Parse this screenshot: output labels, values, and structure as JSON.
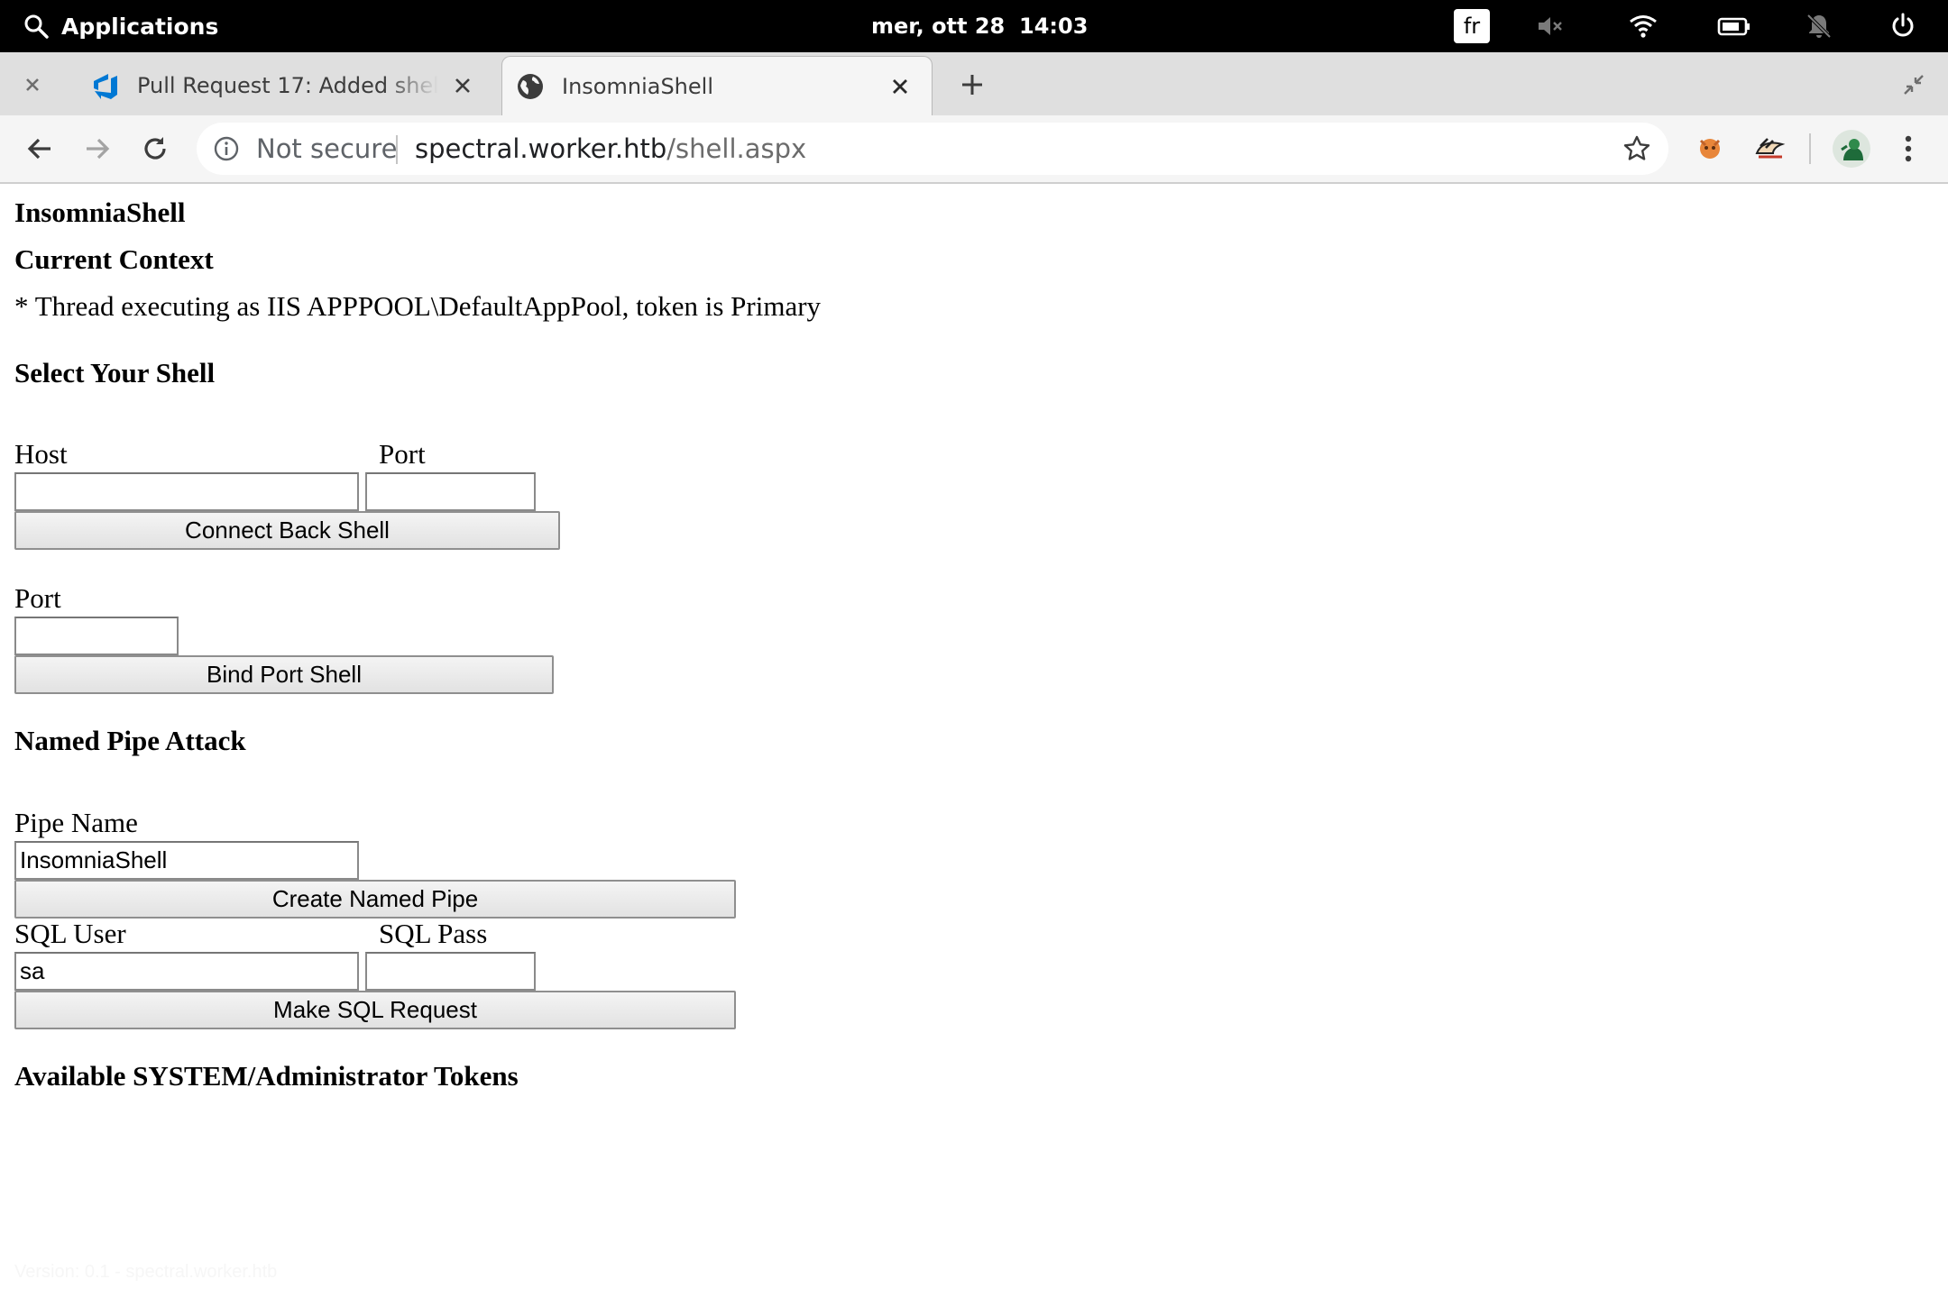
{
  "system_bar": {
    "applications_label": "Applications",
    "date": "mer, ott 28",
    "time": "14:03",
    "keyboard_layout": "fr"
  },
  "browser": {
    "tabs": [
      {
        "title": "Pull Request 17: Added shell.aspx",
        "icon": "azure-devops-icon",
        "active": false
      },
      {
        "title": "InsomniaShell",
        "icon": "globe-icon",
        "active": true
      }
    ],
    "omnibox": {
      "security_label": "Not secure",
      "url_host": "spectral.worker.htb",
      "url_path": "/shell.aspx"
    }
  },
  "page": {
    "title": "InsomniaShell",
    "current_context_heading": "Current Context",
    "context_line": "* Thread executing as IIS APPPOOL\\DefaultAppPool, token is Primary",
    "select_shell_heading": "Select Your Shell",
    "connect_back": {
      "host_label": "Host",
      "port_label": "Port",
      "host_value": "",
      "port_value": "",
      "button": "Connect Back Shell"
    },
    "bind_port": {
      "port_label": "Port",
      "port_value": "",
      "button": "Bind Port Shell"
    },
    "named_pipe_heading": "Named Pipe Attack",
    "named_pipe": {
      "pipe_name_label": "Pipe Name",
      "pipe_name_value": "InsomniaShell",
      "button": "Create Named Pipe",
      "sql_user_label": "SQL User",
      "sql_user_value": "sa",
      "sql_pass_label": "SQL Pass",
      "sql_pass_value": "",
      "sql_button": "Make SQL Request"
    },
    "tokens_heading": "Available SYSTEM/Administrator Tokens",
    "footer_text": "Version: 0.1 - spectral.worker.htb"
  },
  "colors": {
    "system_bar_bg": "#000000",
    "tab_strip_bg": "#dfdfdf",
    "toolbar_bg": "#f5f5f5",
    "page_bg": "#ffffff"
  }
}
